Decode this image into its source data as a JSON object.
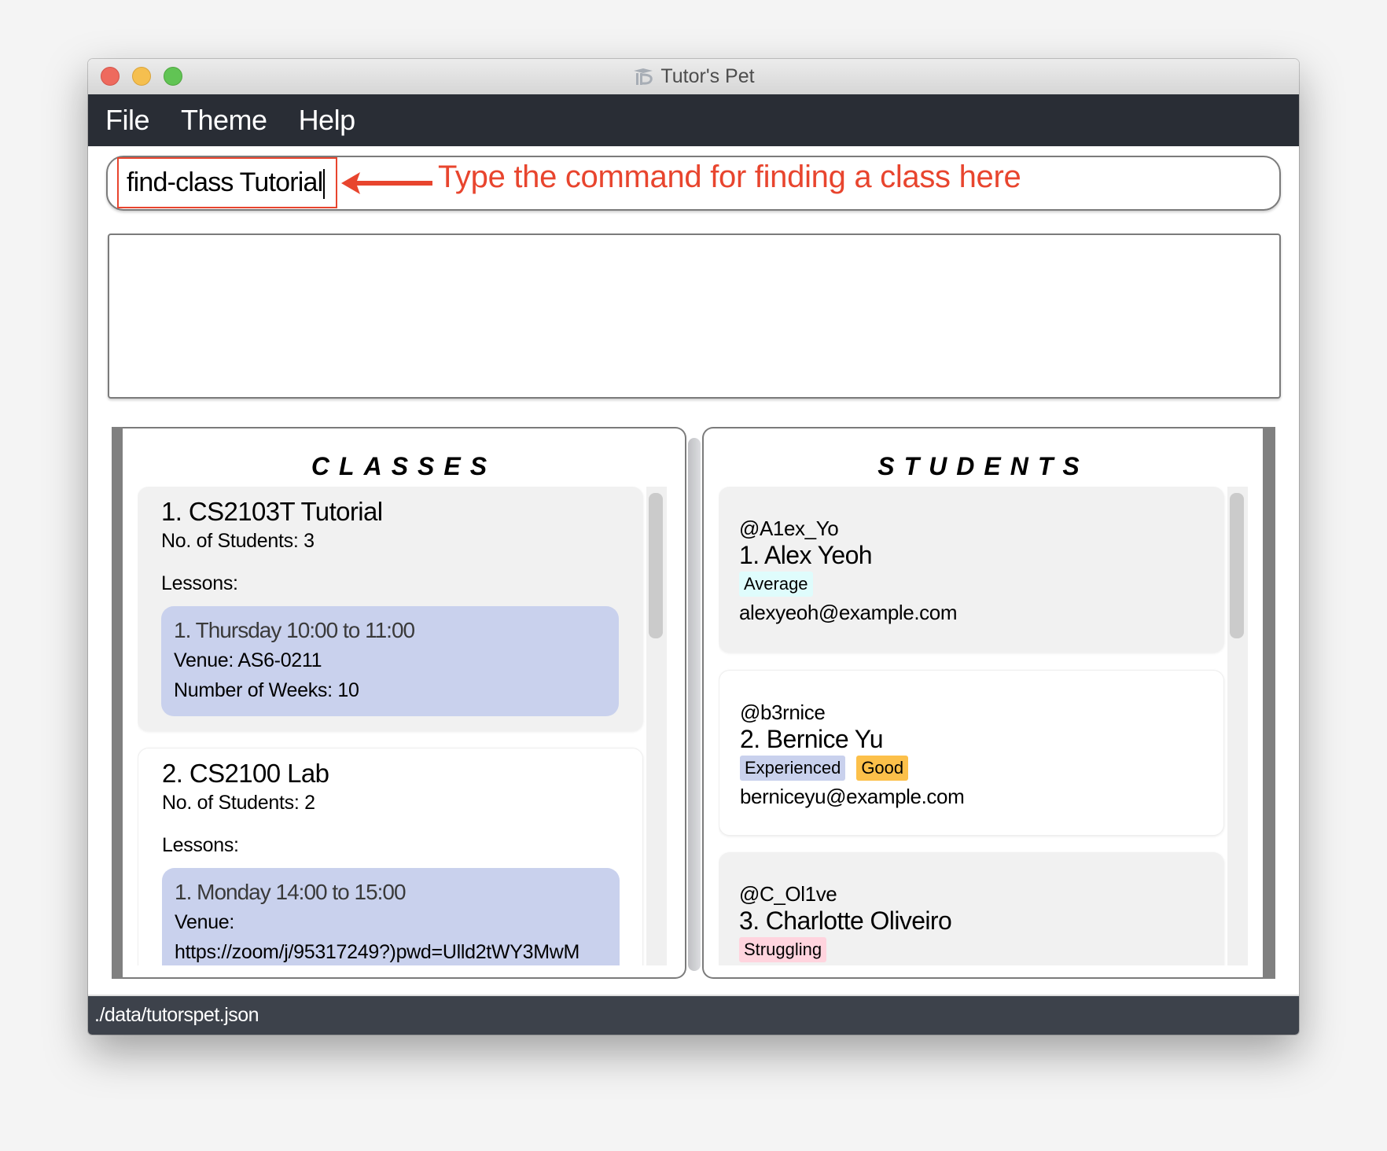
{
  "window": {
    "title": "Tutor's Pet",
    "title_icon": "app-logo-icon",
    "traffic_lights": [
      "close",
      "minimize",
      "maximize"
    ]
  },
  "menubar": {
    "items": [
      {
        "label": "File"
      },
      {
        "label": "Theme"
      },
      {
        "label": "Help"
      }
    ]
  },
  "command": {
    "value": "find-class Tutorial",
    "annotation": "Type the command for finding a class here",
    "annotation_color": "#e8452e"
  },
  "result_display": {
    "text": ""
  },
  "classes_panel": {
    "title": "CLASSES",
    "items": [
      {
        "name": "1.  CS2103T Tutorial",
        "students": "No. of Students:  3",
        "lessons_label": "Lessons:",
        "lessons": [
          {
            "time": "1. Thursday 10:00 to 11:00",
            "venue": "Venue: AS6-0211",
            "weeks": "Number of Weeks: 10"
          }
        ]
      },
      {
        "name": "2.  CS2100 Lab",
        "students": "No. of Students:  2",
        "lessons_label": "Lessons:",
        "lessons": [
          {
            "time": "1. Monday 14:00 to 15:00",
            "venue": "Venue:",
            "venue_url": "https://zoom/j/95317249?)pwd=Ulld2tWY3MwM"
          }
        ]
      }
    ]
  },
  "students_panel": {
    "title": "STUDENTS",
    "items": [
      {
        "handle": "@A1ex_Yo",
        "name": "1.  Alex Yeoh",
        "tags": [
          {
            "label": "Average",
            "color": "#dffcfc"
          }
        ],
        "email": "alexyeoh@example.com"
      },
      {
        "handle": "@b3rnice",
        "name": "2.  Bernice Yu",
        "tags": [
          {
            "label": "Experienced",
            "color": "#c9d1ed"
          },
          {
            "label": "Good",
            "color": "#fcc04a"
          }
        ],
        "email": "berniceyu@example.com"
      },
      {
        "handle": "@C_Ol1ve",
        "name": "3.  Charlotte Oliveiro",
        "tags": [
          {
            "label": "Struggling",
            "color": "#ffd4de"
          }
        ],
        "email": ""
      }
    ]
  },
  "statusbar": {
    "path": "./data/tutorspet.json"
  }
}
